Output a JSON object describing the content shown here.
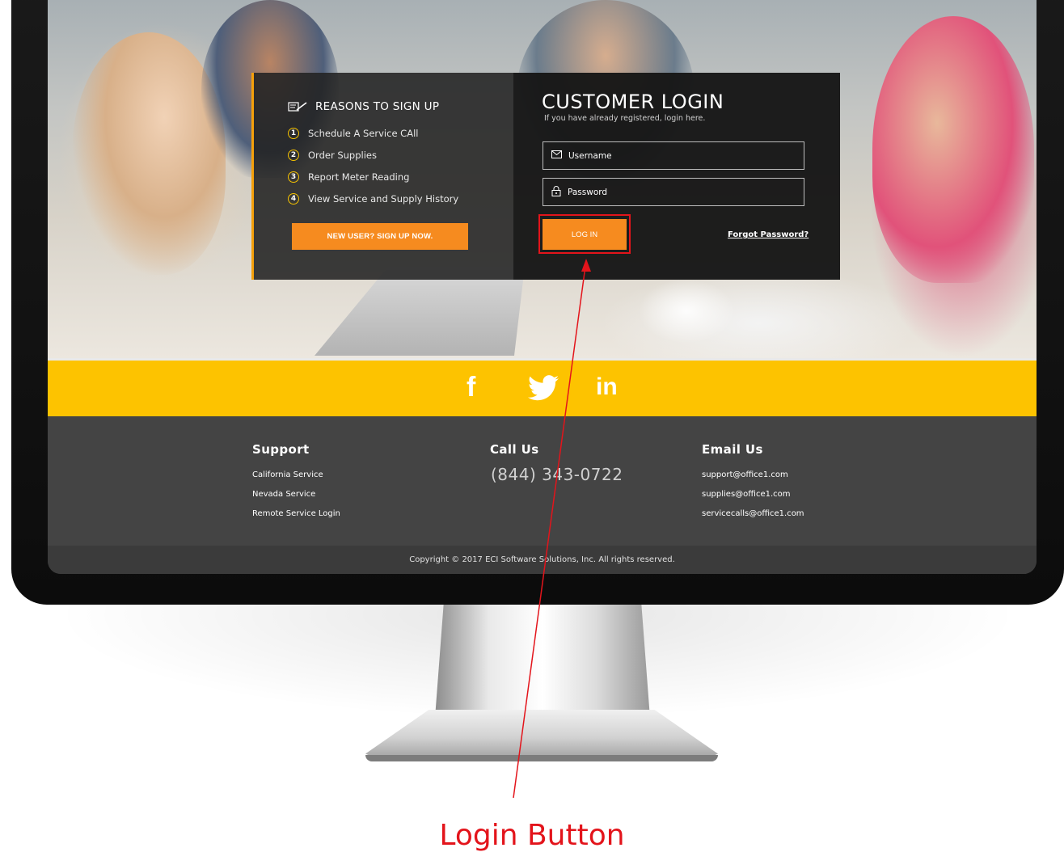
{
  "signup_panel": {
    "heading": "REASONS TO SIGN UP",
    "reasons": [
      {
        "num": "1",
        "label": "Schedule A Service CAll"
      },
      {
        "num": "2",
        "label": "Order Supplies"
      },
      {
        "num": "3",
        "label": "Report Meter Reading"
      },
      {
        "num": "4",
        "label": "View Service and Supply History"
      }
    ],
    "signup_button": "NEW USER? SIGN UP NOW."
  },
  "login_panel": {
    "title": "CUSTOMER LOGIN",
    "subtitle": "If you have already registered, login here.",
    "username_placeholder": "Username",
    "password_placeholder": "Password",
    "login_button": "LOG IN",
    "forgot_link": "Forgot Password?"
  },
  "social": {
    "facebook": "f",
    "linkedin": "in"
  },
  "footer": {
    "support": {
      "heading": "Support",
      "links": [
        "California Service",
        "Nevada Service",
        "Remote Service Login"
      ]
    },
    "call": {
      "heading": "Call Us",
      "phone": "(844) 343-0722"
    },
    "email": {
      "heading": "Email Us",
      "links": [
        "support@office1.com",
        "supplies@office1.com",
        "servicecalls@office1.com"
      ]
    },
    "copyright": "Copyright © 2017 ECI Software Solutions, Inc. All rights reserved."
  },
  "annotation": {
    "label": "Login Button",
    "color": "#e3141b"
  },
  "colors": {
    "accent_orange": "#f68b1f",
    "social_yellow": "#fdc300",
    "footer_gray": "#444444"
  }
}
